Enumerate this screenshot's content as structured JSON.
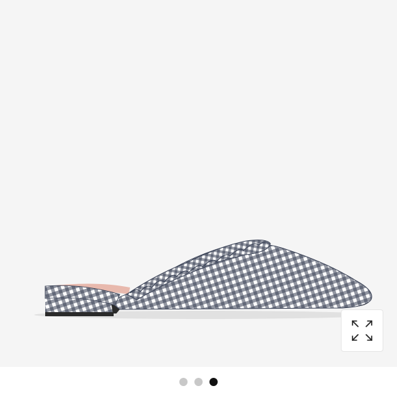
{
  "product_image": {
    "icon": "gingham-mule-shoe-photo",
    "colors": {
      "background": "#f5f5f5",
      "gingham_dark": "#3a4256",
      "gingham_light": "#ffffff",
      "lining_pink": "#e8b9ad"
    }
  },
  "expand_button": {
    "icon": "expand-arrows-icon"
  },
  "carousel": {
    "slide_count": 3,
    "active_index": 2,
    "dot_color": "#c8c8c8",
    "active_dot_color": "#111111"
  }
}
